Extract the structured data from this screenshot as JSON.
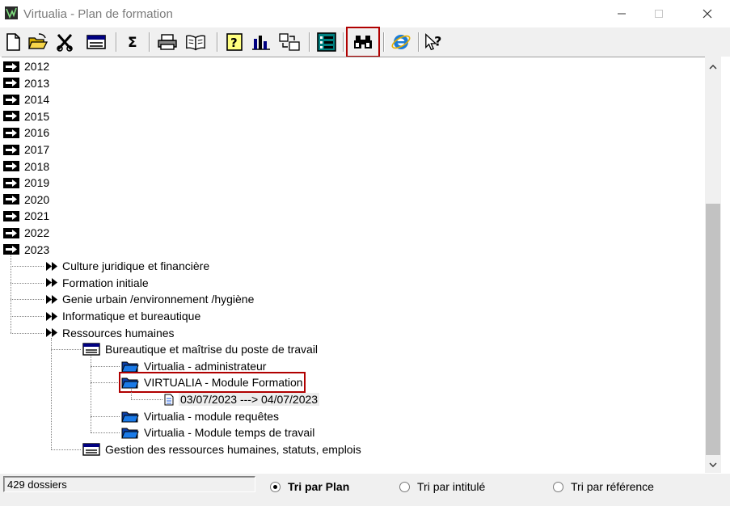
{
  "window": {
    "title": "Virtualia - Plan de formation"
  },
  "toolbar": {
    "buttons": [
      {
        "name": "new-document-icon"
      },
      {
        "name": "open-folder-icon"
      },
      {
        "name": "delete-icon"
      },
      {
        "name": "window-icon"
      },
      {
        "name": "sum-icon"
      },
      {
        "name": "printer-icon"
      },
      {
        "name": "book-icon"
      },
      {
        "name": "help-icon"
      },
      {
        "name": "chart-icon"
      },
      {
        "name": "transfer-icon"
      },
      {
        "name": "list-icon"
      },
      {
        "name": "binoculars-icon"
      },
      {
        "name": "internet-explorer-icon"
      },
      {
        "name": "context-help-icon"
      }
    ],
    "selected": "binoculars-icon"
  },
  "tree": {
    "years": [
      "2012",
      "2013",
      "2014",
      "2015",
      "2016",
      "2017",
      "2018",
      "2019",
      "2020",
      "2021",
      "2022",
      "2023"
    ],
    "domains": [
      "Culture juridique et financière",
      "Formation initiale",
      "Genie urbain /environnement /hygiène",
      "Informatique et bureautique",
      "Ressources humaines"
    ],
    "groups": [
      "Bureautique et maîtrise du poste de travail",
      "Gestion des ressources humaines, statuts, emplois"
    ],
    "modules": [
      "Virtualia - administrateur",
      "VIRTUALIA - Module Formation",
      "Virtualia - module requêtes",
      "Virtualia - Module temps de travail"
    ],
    "session": "03/07/2023 ---> 04/07/2023"
  },
  "status": {
    "count": "429 dossiers",
    "sort_options": [
      "Tri par Plan",
      "Tri par intitulé",
      "Tri par référence"
    ],
    "selected_sort": "Tri par Plan"
  },
  "colors": {
    "highlight_border": "#b00000",
    "folder_blue": "#1a5adb"
  }
}
